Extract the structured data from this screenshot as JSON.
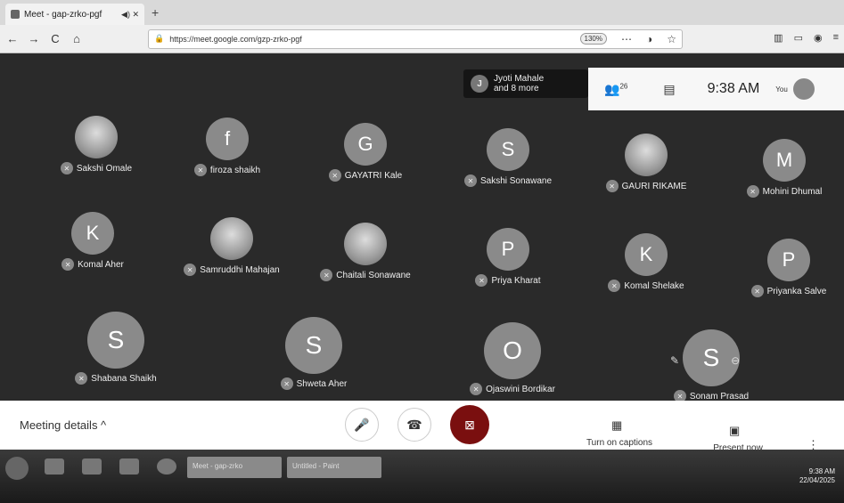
{
  "browser": {
    "tab_title": "Meet - gap-zrko-pgf",
    "tab_controls": "◀) ✕",
    "new_tab": "+",
    "url": "https://meet.google.com/gzp-zrko-pgf",
    "zoom": "130%",
    "menu": "⋯",
    "nav": [
      "←",
      "→",
      "C",
      "⌂"
    ]
  },
  "presence": {
    "avatar_letter": "J",
    "text_line1": "Jyoti Mahale",
    "text_line2": "and 8 more"
  },
  "topbar": {
    "people_count": "26",
    "time": "9:38 AM",
    "you_label": "You"
  },
  "participants": [
    {
      "name": "Sakshi Omale",
      "initial": "",
      "photo": true
    },
    {
      "name": "firoza shaikh",
      "initial": "f",
      "photo": false
    },
    {
      "name": "GAYATRI Kale",
      "initial": "G",
      "photo": false
    },
    {
      "name": "Sakshi Sonawane",
      "initial": "S",
      "photo": false
    },
    {
      "name": "GAURI RIKAME",
      "initial": "",
      "photo": true
    },
    {
      "name": "Mohini Dhumal",
      "initial": "M",
      "photo": false
    },
    {
      "name": "Komal Aher",
      "initial": "K",
      "photo": false
    },
    {
      "name": "Samruddhi Mahajan",
      "initial": "",
      "photo": true
    },
    {
      "name": "Chaitali Sonawane",
      "initial": "",
      "photo": true
    },
    {
      "name": "Priya Kharat",
      "initial": "P",
      "photo": false
    },
    {
      "name": "Komal Shelake",
      "initial": "K",
      "photo": false
    },
    {
      "name": "Priyanka Salve",
      "initial": "P",
      "photo": false
    },
    {
      "name": "Shabana Shaikh",
      "initial": "S",
      "photo": false
    },
    {
      "name": "Shweta Aher",
      "initial": "S",
      "photo": false
    },
    {
      "name": "Ojaswini Bordikar",
      "initial": "O",
      "photo": false
    },
    {
      "name": "Sonam Prasad",
      "initial": "S",
      "photo": false
    }
  ],
  "controls": {
    "meeting_details": "Meeting details  ^",
    "captions_label": "Turn on captions",
    "present_label": "Present now",
    "more": "⋮"
  },
  "taskbar": {
    "win1": "Meet - gap-zrko",
    "win2": "Untitled - Paint",
    "time": "9:38 AM",
    "date": "22/04/2025"
  }
}
